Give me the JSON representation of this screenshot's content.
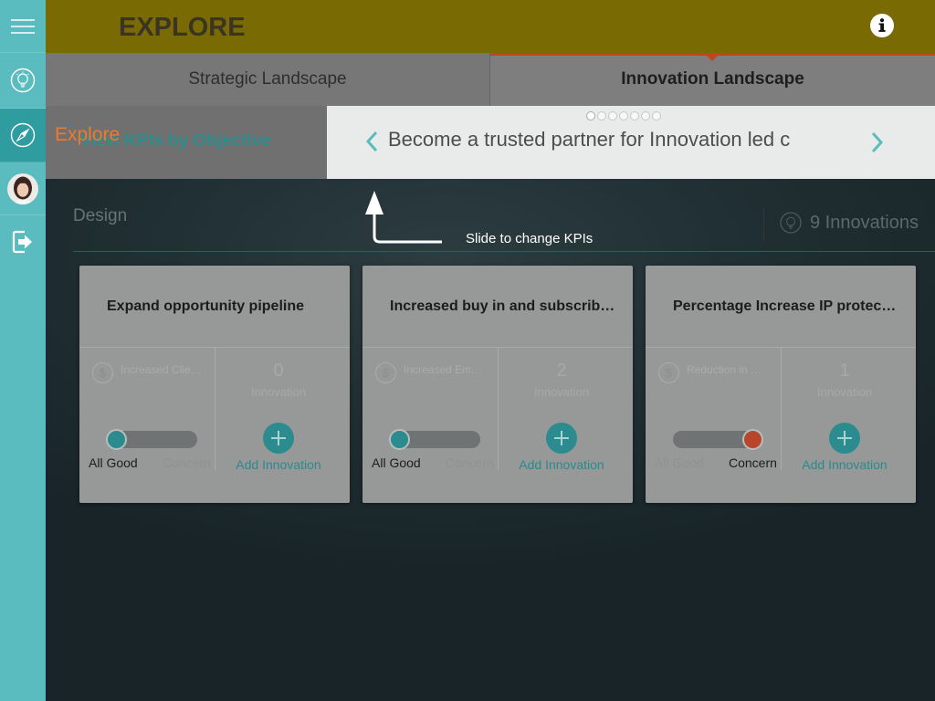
{
  "colors": {
    "sidebar": "#5bbcbf",
    "sidebar_selected": "#2f9ca0",
    "header": "#7a6a04",
    "tab_indicator": "#c3441e",
    "accent_teal": "#2c8b8e",
    "coachmark_title": "#ef7a2c",
    "concern": "#b9452b"
  },
  "sidebar": {
    "items": [
      {
        "icon": "menu-icon",
        "selected": false
      },
      {
        "icon": "lightbulb-icon",
        "selected": false
      },
      {
        "icon": "compass-icon",
        "selected": true
      },
      {
        "icon": "avatar",
        "selected": false
      },
      {
        "icon": "logout-icon",
        "selected": false
      }
    ]
  },
  "header": {
    "title": "EXPLORE",
    "info_icon": "info-icon"
  },
  "tabs": [
    {
      "label": "Strategic Landscape",
      "active": false
    },
    {
      "label": "Innovation Landscape",
      "active": true
    }
  ],
  "objective_bar": {
    "label": "View KPIs by Objective",
    "objective": "Become a trusted partner for Innovation led c",
    "page_count": 7,
    "current_page": 1,
    "prev_icon": "chevron-left-icon",
    "next_icon": "chevron-right-icon"
  },
  "coachmark": {
    "title": "Explore",
    "hint": "Slide to change KPIs",
    "icon": "arrow-up-icon"
  },
  "section": {
    "name": "Design",
    "innovations": "9 Innovations",
    "icon": "lightbulb-icon"
  },
  "cards": [
    {
      "title": "Expand opportunity pipeline",
      "kpi_icon": "dollar-icon",
      "kpi": "Increased Clie…",
      "count": 0,
      "count_label": "Innovation",
      "status_labels": [
        "All Good",
        "Concern"
      ],
      "toggle": 0,
      "add_label": "Add Innovation"
    },
    {
      "title": "Increased buy in and subscrib…",
      "kpi_icon": "dollar-icon",
      "kpi": "Increased Em…",
      "count": 2,
      "count_label": "Innovation",
      "status_labels": [
        "All Good",
        "Concern"
      ],
      "toggle": 0,
      "add_label": "Add Innovation"
    },
    {
      "title": "Percentage Increase IP protec…",
      "kpi_icon": "dollar-icon",
      "kpi": "Reduction in …",
      "count": 1,
      "count_label": "Innovation",
      "status_labels": [
        "All Good",
        "Concern"
      ],
      "toggle": 1,
      "add_label": "Add Innovation"
    }
  ]
}
